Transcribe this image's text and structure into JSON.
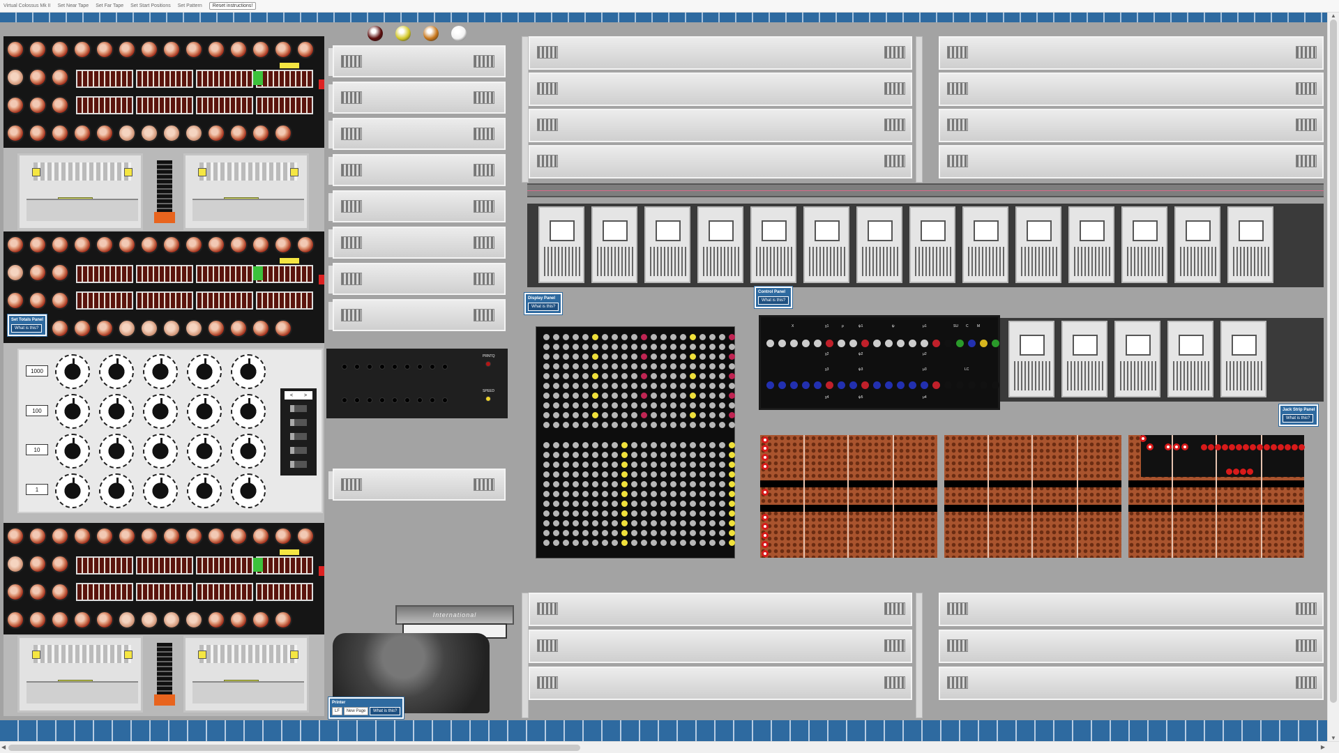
{
  "menu": {
    "title": "Virtual Colossus Mk II",
    "items": [
      "Set Near Tape",
      "Set Far Tape",
      "Set Start Positions",
      "Set Pattern"
    ],
    "reset": "Reset instructions!"
  },
  "panels": {
    "set_totals": {
      "title": "Set Totals Panel",
      "button": "What is this?"
    },
    "display": {
      "title": "Display Panel",
      "button": "What is this?"
    },
    "control": {
      "title": "Control Panel",
      "button": "What is this?"
    },
    "jack_strip": {
      "title": "Jack Strip Panel",
      "button": "What is this?"
    },
    "printer": {
      "title": "Printer",
      "lf": "LF",
      "new_page": "New Page",
      "button": "What is this?"
    }
  },
  "set_totals": {
    "values": [
      "1000",
      "100",
      "10",
      "1"
    ],
    "nav_left": "<",
    "nav_right": ">"
  },
  "knob_panel": {
    "printq": "PRNTQ",
    "speed": "SPEED"
  },
  "control_panel": {
    "top_labels": [
      "X",
      "χ1",
      "ρ",
      "ψ1",
      "ψ",
      "μ1",
      "SU",
      "C",
      "M"
    ],
    "row2_labels": [
      "χ2",
      "ψ2",
      "μ2"
    ],
    "row3_labels": [
      "χ3",
      "ψ3",
      "μ3",
      "LC"
    ],
    "row4_labels": [
      "χ4",
      "ψ5",
      "μ4"
    ]
  },
  "typewriter_brand": "International",
  "lamps": [
    {
      "color": "#5a0c0c"
    },
    {
      "color": "#d4c92a"
    },
    {
      "color": "#c9781c"
    },
    {
      "color": "#f2f2f2"
    }
  ]
}
